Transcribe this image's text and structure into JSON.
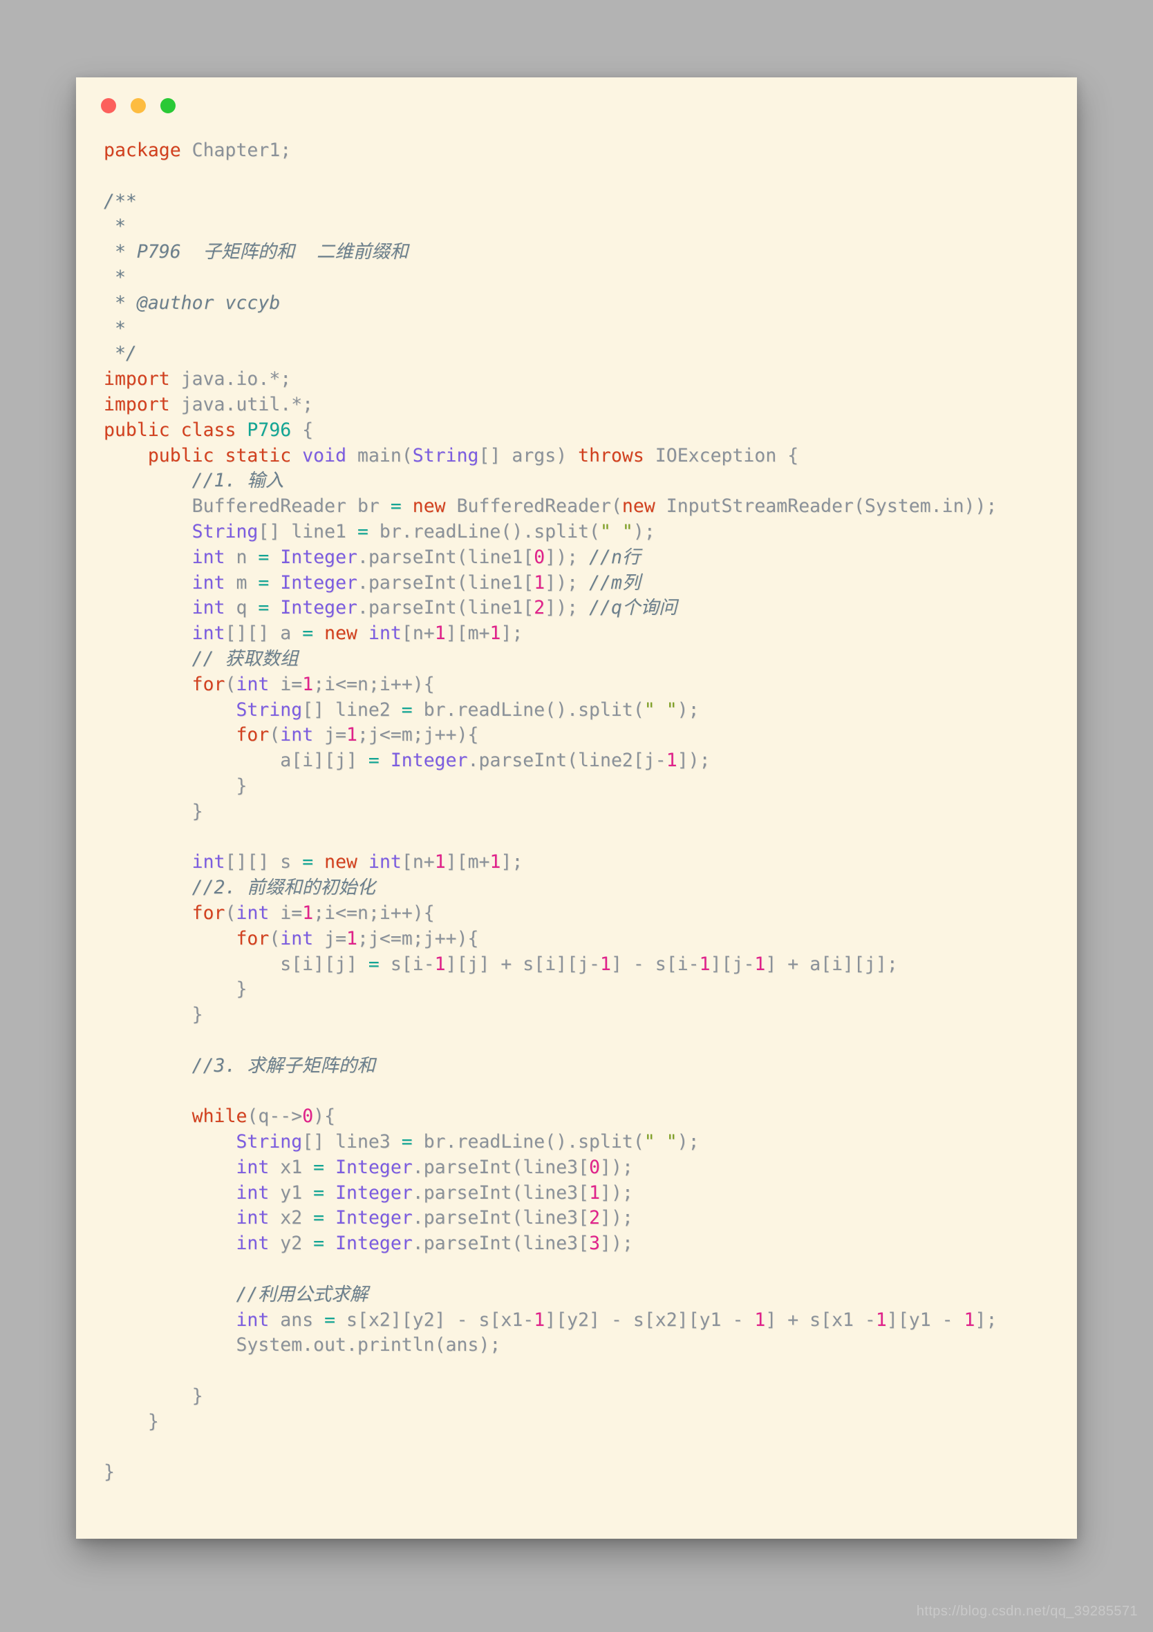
{
  "window": {
    "traffic_lights": [
      {
        "name": "close",
        "color": "#fc605c"
      },
      {
        "name": "minimize",
        "color": "#fdbc40"
      },
      {
        "name": "maximize",
        "color": "#2ac936"
      }
    ],
    "background": "#fcf5e2",
    "page_background": "#b3b3b3"
  },
  "watermark": {
    "text": "https://blog.csdn.net/qq_39285571"
  },
  "code": {
    "language": "java",
    "theme_colors": {
      "keyword": "#d2401e",
      "type": "#7b5ce0",
      "class": "#12a594",
      "identifier": "#8a9199",
      "number": "#e0218a",
      "string": "#7d9f24",
      "comment": "#6b7f8c",
      "operator": "#12a594",
      "background": "#fcf5e2"
    },
    "lines": [
      [
        {
          "t": "package",
          "c": "kw"
        },
        {
          "t": " Chapter1;",
          "c": "id"
        }
      ],
      [],
      [
        {
          "t": "/**",
          "c": "cmt"
        }
      ],
      [
        {
          "t": " *",
          "c": "cmt"
        }
      ],
      [
        {
          "t": " * P796  子矩阵的和  二维前缀和",
          "c": "cmt"
        }
      ],
      [
        {
          "t": " *",
          "c": "cmt"
        }
      ],
      [
        {
          "t": " * @author vccyb",
          "c": "cmt"
        }
      ],
      [
        {
          "t": " *",
          "c": "cmt"
        }
      ],
      [
        {
          "t": " */",
          "c": "cmt"
        }
      ],
      [
        {
          "t": "import",
          "c": "kw"
        },
        {
          "t": " java.io.*;",
          "c": "id"
        }
      ],
      [
        {
          "t": "import",
          "c": "kw"
        },
        {
          "t": " java.util.*;",
          "c": "id"
        }
      ],
      [
        {
          "t": "public class",
          "c": "kw"
        },
        {
          "t": " ",
          "c": "id"
        },
        {
          "t": "P796",
          "c": "cls"
        },
        {
          "t": " {",
          "c": "id"
        }
      ],
      [
        {
          "t": "    ",
          "c": "id"
        },
        {
          "t": "public static",
          "c": "kw"
        },
        {
          "t": " ",
          "c": "id"
        },
        {
          "t": "void",
          "c": "typ"
        },
        {
          "t": " main(",
          "c": "id"
        },
        {
          "t": "String",
          "c": "typ"
        },
        {
          "t": "[] args) ",
          "c": "id"
        },
        {
          "t": "throws",
          "c": "kw"
        },
        {
          "t": " IOException {",
          "c": "id"
        }
      ],
      [
        {
          "t": "        ",
          "c": "id"
        },
        {
          "t": "//1. 输入",
          "c": "cmt"
        }
      ],
      [
        {
          "t": "        BufferedReader br ",
          "c": "id"
        },
        {
          "t": "=",
          "c": "op"
        },
        {
          "t": " ",
          "c": "id"
        },
        {
          "t": "new",
          "c": "kw"
        },
        {
          "t": " BufferedReader(",
          "c": "id"
        },
        {
          "t": "new",
          "c": "kw"
        },
        {
          "t": " InputStreamReader(System.in));",
          "c": "id"
        }
      ],
      [
        {
          "t": "        ",
          "c": "id"
        },
        {
          "t": "String",
          "c": "typ"
        },
        {
          "t": "[] line1 ",
          "c": "id"
        },
        {
          "t": "=",
          "c": "op"
        },
        {
          "t": " br.readLine().split(",
          "c": "id"
        },
        {
          "t": "\" \"",
          "c": "str"
        },
        {
          "t": ");",
          "c": "id"
        }
      ],
      [
        {
          "t": "        ",
          "c": "id"
        },
        {
          "t": "int",
          "c": "typ"
        },
        {
          "t": " n ",
          "c": "id"
        },
        {
          "t": "=",
          "c": "op"
        },
        {
          "t": " ",
          "c": "id"
        },
        {
          "t": "Integer",
          "c": "typ"
        },
        {
          "t": ".parseInt(line1[",
          "c": "id"
        },
        {
          "t": "0",
          "c": "num"
        },
        {
          "t": "]); ",
          "c": "id"
        },
        {
          "t": "//n行",
          "c": "cmt"
        }
      ],
      [
        {
          "t": "        ",
          "c": "id"
        },
        {
          "t": "int",
          "c": "typ"
        },
        {
          "t": " m ",
          "c": "id"
        },
        {
          "t": "=",
          "c": "op"
        },
        {
          "t": " ",
          "c": "id"
        },
        {
          "t": "Integer",
          "c": "typ"
        },
        {
          "t": ".parseInt(line1[",
          "c": "id"
        },
        {
          "t": "1",
          "c": "num"
        },
        {
          "t": "]); ",
          "c": "id"
        },
        {
          "t": "//m列",
          "c": "cmt"
        }
      ],
      [
        {
          "t": "        ",
          "c": "id"
        },
        {
          "t": "int",
          "c": "typ"
        },
        {
          "t": " q ",
          "c": "id"
        },
        {
          "t": "=",
          "c": "op"
        },
        {
          "t": " ",
          "c": "id"
        },
        {
          "t": "Integer",
          "c": "typ"
        },
        {
          "t": ".parseInt(line1[",
          "c": "id"
        },
        {
          "t": "2",
          "c": "num"
        },
        {
          "t": "]); ",
          "c": "id"
        },
        {
          "t": "//q个询问",
          "c": "cmt"
        }
      ],
      [
        {
          "t": "        ",
          "c": "id"
        },
        {
          "t": "int",
          "c": "typ"
        },
        {
          "t": "[][] a ",
          "c": "id"
        },
        {
          "t": "=",
          "c": "op"
        },
        {
          "t": " ",
          "c": "id"
        },
        {
          "t": "new",
          "c": "kw"
        },
        {
          "t": " ",
          "c": "id"
        },
        {
          "t": "int",
          "c": "typ"
        },
        {
          "t": "[n+",
          "c": "id"
        },
        {
          "t": "1",
          "c": "num"
        },
        {
          "t": "][m+",
          "c": "id"
        },
        {
          "t": "1",
          "c": "num"
        },
        {
          "t": "];",
          "c": "id"
        }
      ],
      [
        {
          "t": "        ",
          "c": "id"
        },
        {
          "t": "// 获取数组",
          "c": "cmt"
        }
      ],
      [
        {
          "t": "        ",
          "c": "id"
        },
        {
          "t": "for",
          "c": "kw"
        },
        {
          "t": "(",
          "c": "id"
        },
        {
          "t": "int",
          "c": "typ"
        },
        {
          "t": " i=",
          "c": "id"
        },
        {
          "t": "1",
          "c": "num"
        },
        {
          "t": ";i<=n;i++){",
          "c": "id"
        }
      ],
      [
        {
          "t": "            ",
          "c": "id"
        },
        {
          "t": "String",
          "c": "typ"
        },
        {
          "t": "[] line2 ",
          "c": "id"
        },
        {
          "t": "=",
          "c": "op"
        },
        {
          "t": " br.readLine().split(",
          "c": "id"
        },
        {
          "t": "\" \"",
          "c": "str"
        },
        {
          "t": ");",
          "c": "id"
        }
      ],
      [
        {
          "t": "            ",
          "c": "id"
        },
        {
          "t": "for",
          "c": "kw"
        },
        {
          "t": "(",
          "c": "id"
        },
        {
          "t": "int",
          "c": "typ"
        },
        {
          "t": " j=",
          "c": "id"
        },
        {
          "t": "1",
          "c": "num"
        },
        {
          "t": ";j<=m;j++){",
          "c": "id"
        }
      ],
      [
        {
          "t": "                a[i][j] ",
          "c": "id"
        },
        {
          "t": "=",
          "c": "op"
        },
        {
          "t": " ",
          "c": "id"
        },
        {
          "t": "Integer",
          "c": "typ"
        },
        {
          "t": ".parseInt(line2[j-",
          "c": "id"
        },
        {
          "t": "1",
          "c": "num"
        },
        {
          "t": "]);",
          "c": "id"
        }
      ],
      [
        {
          "t": "            }",
          "c": "id"
        }
      ],
      [
        {
          "t": "        }",
          "c": "id"
        }
      ],
      [],
      [
        {
          "t": "        ",
          "c": "id"
        },
        {
          "t": "int",
          "c": "typ"
        },
        {
          "t": "[][] s ",
          "c": "id"
        },
        {
          "t": "=",
          "c": "op"
        },
        {
          "t": " ",
          "c": "id"
        },
        {
          "t": "new",
          "c": "kw"
        },
        {
          "t": " ",
          "c": "id"
        },
        {
          "t": "int",
          "c": "typ"
        },
        {
          "t": "[n+",
          "c": "id"
        },
        {
          "t": "1",
          "c": "num"
        },
        {
          "t": "][m+",
          "c": "id"
        },
        {
          "t": "1",
          "c": "num"
        },
        {
          "t": "];",
          "c": "id"
        }
      ],
      [
        {
          "t": "        ",
          "c": "id"
        },
        {
          "t": "//2. 前缀和的初始化",
          "c": "cmt"
        }
      ],
      [
        {
          "t": "        ",
          "c": "id"
        },
        {
          "t": "for",
          "c": "kw"
        },
        {
          "t": "(",
          "c": "id"
        },
        {
          "t": "int",
          "c": "typ"
        },
        {
          "t": " i=",
          "c": "id"
        },
        {
          "t": "1",
          "c": "num"
        },
        {
          "t": ";i<=n;i++){",
          "c": "id"
        }
      ],
      [
        {
          "t": "            ",
          "c": "id"
        },
        {
          "t": "for",
          "c": "kw"
        },
        {
          "t": "(",
          "c": "id"
        },
        {
          "t": "int",
          "c": "typ"
        },
        {
          "t": " j=",
          "c": "id"
        },
        {
          "t": "1",
          "c": "num"
        },
        {
          "t": ";j<=m;j++){",
          "c": "id"
        }
      ],
      [
        {
          "t": "                s[i][j] ",
          "c": "id"
        },
        {
          "t": "=",
          "c": "op"
        },
        {
          "t": " s[i-",
          "c": "id"
        },
        {
          "t": "1",
          "c": "num"
        },
        {
          "t": "][j] + s[i][j-",
          "c": "id"
        },
        {
          "t": "1",
          "c": "num"
        },
        {
          "t": "] - s[i-",
          "c": "id"
        },
        {
          "t": "1",
          "c": "num"
        },
        {
          "t": "][j-",
          "c": "id"
        },
        {
          "t": "1",
          "c": "num"
        },
        {
          "t": "] + a[i][j];",
          "c": "id"
        }
      ],
      [
        {
          "t": "            }",
          "c": "id"
        }
      ],
      [
        {
          "t": "        }",
          "c": "id"
        }
      ],
      [],
      [
        {
          "t": "        ",
          "c": "id"
        },
        {
          "t": "//3. 求解子矩阵的和",
          "c": "cmt"
        }
      ],
      [],
      [
        {
          "t": "        ",
          "c": "id"
        },
        {
          "t": "while",
          "c": "kw"
        },
        {
          "t": "(q-->",
          "c": "id"
        },
        {
          "t": "0",
          "c": "num"
        },
        {
          "t": "){",
          "c": "id"
        }
      ],
      [
        {
          "t": "            ",
          "c": "id"
        },
        {
          "t": "String",
          "c": "typ"
        },
        {
          "t": "[] line3 ",
          "c": "id"
        },
        {
          "t": "=",
          "c": "op"
        },
        {
          "t": " br.readLine().split(",
          "c": "id"
        },
        {
          "t": "\" \"",
          "c": "str"
        },
        {
          "t": ");",
          "c": "id"
        }
      ],
      [
        {
          "t": "            ",
          "c": "id"
        },
        {
          "t": "int",
          "c": "typ"
        },
        {
          "t": " x1 ",
          "c": "id"
        },
        {
          "t": "=",
          "c": "op"
        },
        {
          "t": " ",
          "c": "id"
        },
        {
          "t": "Integer",
          "c": "typ"
        },
        {
          "t": ".parseInt(line3[",
          "c": "id"
        },
        {
          "t": "0",
          "c": "num"
        },
        {
          "t": "]);",
          "c": "id"
        }
      ],
      [
        {
          "t": "            ",
          "c": "id"
        },
        {
          "t": "int",
          "c": "typ"
        },
        {
          "t": " y1 ",
          "c": "id"
        },
        {
          "t": "=",
          "c": "op"
        },
        {
          "t": " ",
          "c": "id"
        },
        {
          "t": "Integer",
          "c": "typ"
        },
        {
          "t": ".parseInt(line3[",
          "c": "id"
        },
        {
          "t": "1",
          "c": "num"
        },
        {
          "t": "]);",
          "c": "id"
        }
      ],
      [
        {
          "t": "            ",
          "c": "id"
        },
        {
          "t": "int",
          "c": "typ"
        },
        {
          "t": " x2 ",
          "c": "id"
        },
        {
          "t": "=",
          "c": "op"
        },
        {
          "t": " ",
          "c": "id"
        },
        {
          "t": "Integer",
          "c": "typ"
        },
        {
          "t": ".parseInt(line3[",
          "c": "id"
        },
        {
          "t": "2",
          "c": "num"
        },
        {
          "t": "]);",
          "c": "id"
        }
      ],
      [
        {
          "t": "            ",
          "c": "id"
        },
        {
          "t": "int",
          "c": "typ"
        },
        {
          "t": " y2 ",
          "c": "id"
        },
        {
          "t": "=",
          "c": "op"
        },
        {
          "t": " ",
          "c": "id"
        },
        {
          "t": "Integer",
          "c": "typ"
        },
        {
          "t": ".parseInt(line3[",
          "c": "id"
        },
        {
          "t": "3",
          "c": "num"
        },
        {
          "t": "]);",
          "c": "id"
        }
      ],
      [],
      [
        {
          "t": "            ",
          "c": "id"
        },
        {
          "t": "//利用公式求解",
          "c": "cmt"
        }
      ],
      [
        {
          "t": "            ",
          "c": "id"
        },
        {
          "t": "int",
          "c": "typ"
        },
        {
          "t": " ans ",
          "c": "id"
        },
        {
          "t": "=",
          "c": "op"
        },
        {
          "t": " s[x2][y2] - s[x1-",
          "c": "id"
        },
        {
          "t": "1",
          "c": "num"
        },
        {
          "t": "][y2] - s[x2][y1 - ",
          "c": "id"
        },
        {
          "t": "1",
          "c": "num"
        },
        {
          "t": "] + s[x1 -",
          "c": "id"
        },
        {
          "t": "1",
          "c": "num"
        },
        {
          "t": "][y1 - ",
          "c": "id"
        },
        {
          "t": "1",
          "c": "num"
        },
        {
          "t": "];",
          "c": "id"
        }
      ],
      [
        {
          "t": "            System.out.println(ans);",
          "c": "id"
        }
      ],
      [],
      [
        {
          "t": "        }",
          "c": "id"
        }
      ],
      [
        {
          "t": "    }",
          "c": "id"
        }
      ],
      [],
      [
        {
          "t": "}",
          "c": "id"
        }
      ]
    ]
  }
}
